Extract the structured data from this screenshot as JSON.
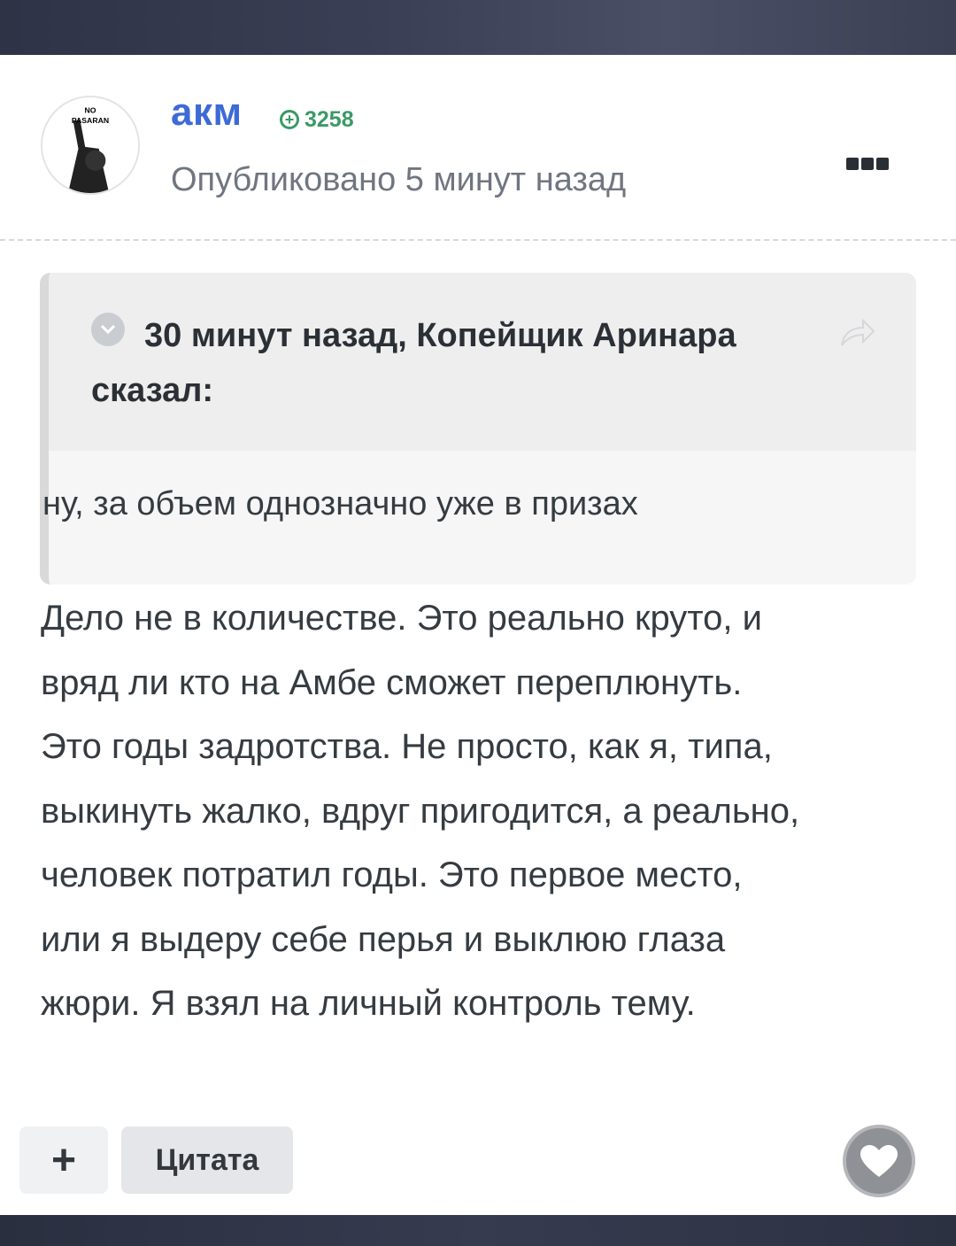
{
  "post": {
    "author": "акм",
    "reputation": "3258",
    "published": "Опубликовано 5 минут назад",
    "avatar_text_1": "NO",
    "avatar_text_2": "PASARAN",
    "quote": {
      "citation": "30 минут назад, Копейщик Аринара сказал:",
      "text": "ну, за объем однозначно уже в призах"
    },
    "body_lines": [
      "Дело не в количестве. Это реально круто, и",
      "вряд ли кто на Амбе сможет переплюнуть.",
      "Это годы задротства. Не просто, как я, типа,",
      "выкинуть жалко, вдруг пригодится, а реально,",
      "человек потратил годы. Это первое место,",
      "или я выдеру себе перья и выклюю глаза",
      "жюри. Я взял на личный контроль тему."
    ]
  },
  "actions": {
    "plus_label": "+",
    "quote_label": "Цитата"
  },
  "icons": {
    "menu": "ellipsis-icon",
    "collapse": "chevron-down-icon",
    "share": "share-arrow-icon",
    "like": "heart-icon",
    "reputation": "plus-circle-icon"
  },
  "colors": {
    "author": "#3d6ad6",
    "reputation": "#3a9a67",
    "body_text": "#353c41"
  }
}
